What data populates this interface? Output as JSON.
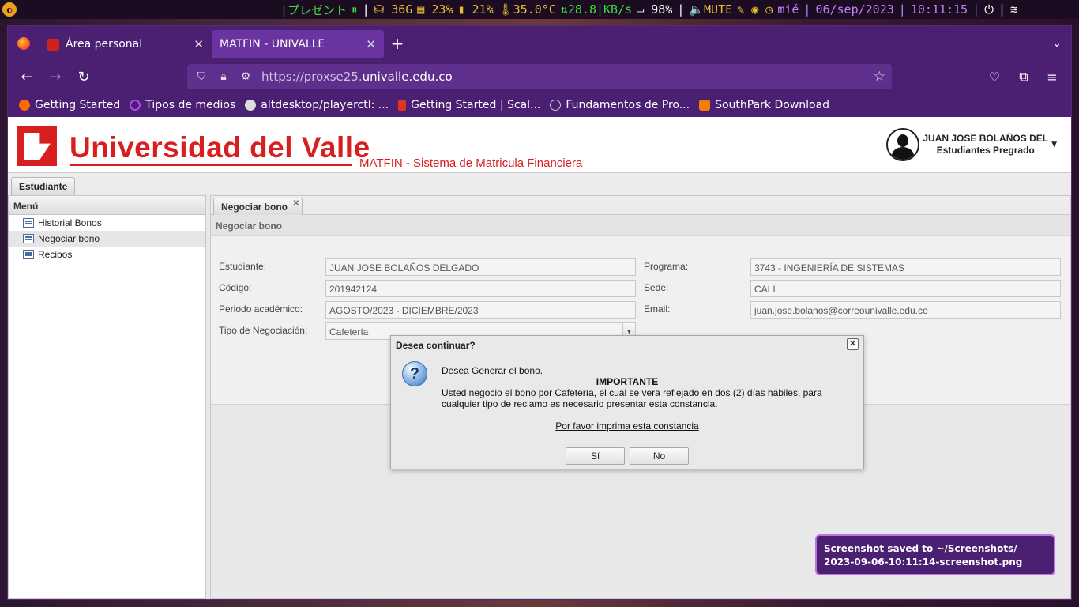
{
  "statusbar": {
    "workspace": "|プレゼント",
    "play": "⏸",
    "disk": "36G",
    "cpu": "23%",
    "mem": "21%",
    "temp": "35.0°C",
    "net": "28.8|KB/s",
    "brightness": "98%",
    "volume": "MUTE",
    "day": "mié",
    "date": "06/sep/2023",
    "time": "10:11:15"
  },
  "browser": {
    "tabs": [
      {
        "label": "Área personal"
      },
      {
        "label": "MATFIN - UNIVALLE"
      }
    ],
    "url_prefix": "https://proxse25.",
    "url_host": "univalle.edu.co",
    "bookmarks": [
      {
        "label": "Getting Started",
        "color": "#ff6a00"
      },
      {
        "label": "Tipos de medios",
        "color": "#b24cf0"
      },
      {
        "label": "altdesktop/playerctl: ...",
        "color": "#dddddd"
      },
      {
        "label": "Getting Started | Scal...",
        "color": "#de3423"
      },
      {
        "label": "Fundamentos de Pro...",
        "color": "#cccccc"
      },
      {
        "label": "SouthPark Download",
        "color": "#f57d00"
      }
    ]
  },
  "header": {
    "university": "Universidad del Valle",
    "system": "MATFIN - Sistema de Matricula Financiera",
    "user_name": "JUAN JOSE BOLAÑOS DEL",
    "user_role": "Estudiantes Pregrado"
  },
  "role_tab": "Estudiante",
  "menu": {
    "title": "Menú",
    "items": [
      {
        "label": "Historial Bonos"
      },
      {
        "label": "Negociar bono"
      },
      {
        "label": "Recibos"
      }
    ]
  },
  "content": {
    "tab": "Negociar bono",
    "panel_title": "Negociar bono",
    "fields": {
      "estudiante_label": "Estudiante:",
      "estudiante": "JUAN JOSE BOLAÑOS DELGADO",
      "codigo_label": "Código:",
      "codigo": "201942124",
      "periodo_label": "Periodo académico:",
      "periodo": "AGOSTO/2023 - DICIEMBRE/2023",
      "tipo_label": "Tipo de Negociación:",
      "tipo": "Cafetería",
      "programa_label": "Programa:",
      "programa": "3743 - INGENIERÍA DE SISTEMAS",
      "sede_label": "Sede:",
      "sede": "CALI",
      "email_label": "Email:",
      "email": "juan.jose.bolanos@correounivalle.edu.co"
    }
  },
  "dialog": {
    "title": "Desea continuar?",
    "question": "Desea Generar el bono.",
    "important": "IMPORTANTE",
    "message": "Usted negocio el bono por Cafetería, el cual se vera reflejado en dos (2) días hábiles, para cualquier tipo de reclamo es necesario presentar esta constancia.",
    "link": "Por favor imprima esta constancia",
    "yes": "Sí",
    "no": "No"
  },
  "notification": {
    "line1": "Screenshot saved to ~/Screenshots/",
    "line2": "2023-09-06-10:11:14-screenshot.png"
  }
}
